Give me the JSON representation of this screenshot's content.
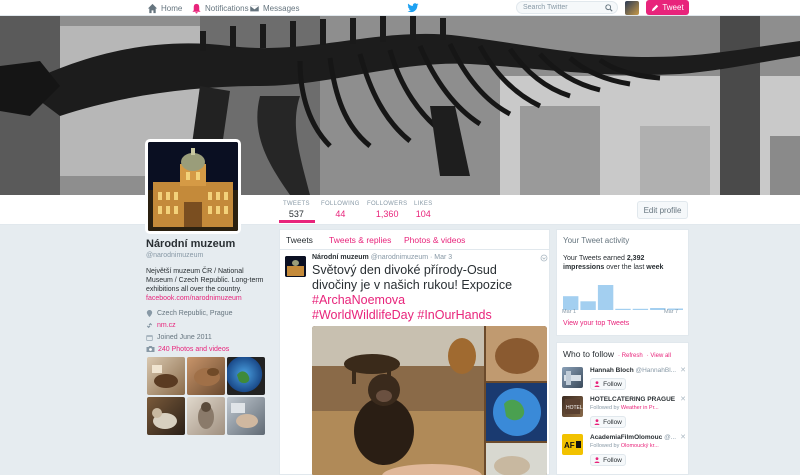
{
  "nav": {
    "home": "Home",
    "notifications": "Notifications",
    "messages": "Messages",
    "search_placeholder": "Search Twitter",
    "tweet_button": "Tweet"
  },
  "profile": {
    "name": "Národní muzeum",
    "handle": "@narodnimuzeum",
    "bio": "Největší muzeum ČR / National Museum / Czech Republic. Long-term exhibitions all over the country.",
    "bio_link": "facebook.com/narodnimuzeum",
    "location": "Czech Republic, Prague",
    "website": "nm.cz",
    "joined": "Joined June 2011",
    "photos_label": "240 Photos and videos",
    "edit_profile": "Edit profile"
  },
  "stats": [
    {
      "label": "TWEETS",
      "value": "537"
    },
    {
      "label": "FOLLOWING",
      "value": "44"
    },
    {
      "label": "FOLLOWERS",
      "value": "1,360"
    },
    {
      "label": "LIKES",
      "value": "104"
    }
  ],
  "tabs": [
    "Tweets",
    "Tweets & replies",
    "Photos & videos"
  ],
  "tweet": {
    "name": "Národní muzeum",
    "handle": "@narodnimuzeum",
    "date": "· Mar 3",
    "text_plain": "Světový den divoké přírody-Osud divočiny je v našich rukou! Expozice",
    "hashtag1": "#ArchaNoemova",
    "hashtag2": "#WorldWildlifeDay",
    "hashtag3": "#InOurHands"
  },
  "activity": {
    "title": "Your Tweet activity",
    "text_pre": "Your Tweets earned",
    "impressions": "2,392 impressions",
    "text_post": "over the last",
    "period": "week",
    "axis_start": "Mar 1",
    "axis_end": "Mar 7",
    "link": "View your top Tweets",
    "chart_bars": [
      0.55,
      0.35,
      1.0,
      0.05,
      0.05,
      0.08,
      0.06
    ]
  },
  "who_to_follow": {
    "title": "Who to follow",
    "refresh": "· Refresh",
    "view_all": "· View all",
    "follow_label": "Follow",
    "items": [
      {
        "name": "Hannah Bloch",
        "handle": "@HannahBl...",
        "sub_pre": "",
        "sub_link": ""
      },
      {
        "name": "HOTELCATERING PRAGUE",
        "handle": "",
        "sub_pre": "Followed by",
        "sub_link": "Weather in Pr..."
      },
      {
        "name": "AcademiaFilmOlomouc",
        "handle": "@...",
        "sub_pre": "Followed by",
        "sub_link": "Olomoucký kr..."
      }
    ]
  },
  "colors": {
    "accent": "#e8247b",
    "background": "#e6ecf0",
    "twitter_blue": "#1da1f2"
  }
}
